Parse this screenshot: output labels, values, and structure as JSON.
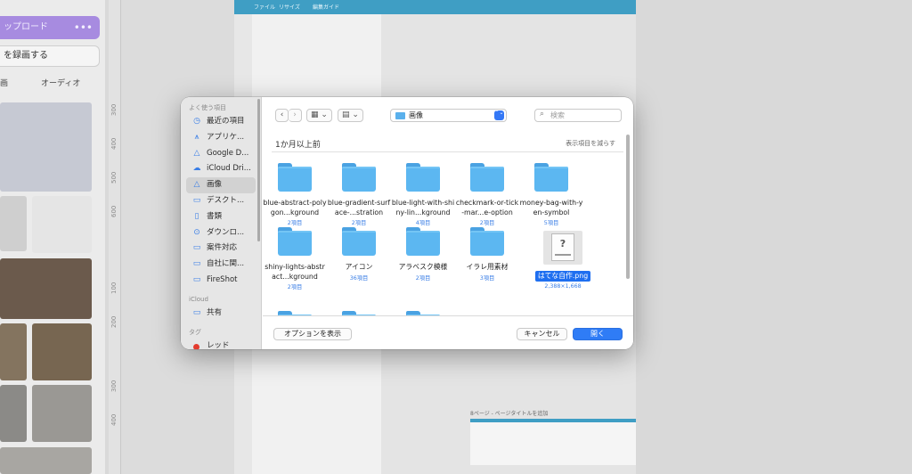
{
  "background": {
    "upload_label": "ップロード",
    "upload_more": "•••",
    "record_label": "を録画する",
    "tab_images": "画",
    "tab_audio": "オーディオ",
    "ruler_ticks": [
      "300",
      "400",
      "500",
      "600",
      "100",
      "200",
      "300",
      "400"
    ],
    "canva_menu": [
      "ファイル",
      "リサイズ",
      "編集ガイド"
    ],
    "page_label": "8ページ - ページタイトルを追加"
  },
  "sidebar": {
    "favorites_header": "よく使う項目",
    "favorites": [
      {
        "label": "最近の項目",
        "icon": "clock-icon",
        "glyph": "◷"
      },
      {
        "label": "アプリケ...",
        "icon": "apps-icon",
        "glyph": "⩚"
      },
      {
        "label": "Google D...",
        "icon": "drive-icon",
        "glyph": "△"
      },
      {
        "label": "iCloud Dri...",
        "icon": "cloud-icon",
        "glyph": "☁"
      },
      {
        "label": "画像",
        "icon": "drive-icon",
        "glyph": "△",
        "active": true
      },
      {
        "label": "デスクト...",
        "icon": "desktop-icon",
        "glyph": "▭"
      },
      {
        "label": "書類",
        "icon": "document-icon",
        "glyph": "▯"
      },
      {
        "label": "ダウンロ...",
        "icon": "download-icon",
        "glyph": "⊙"
      },
      {
        "label": "案件対応",
        "icon": "folder-icon",
        "glyph": "▭"
      },
      {
        "label": "自社に関...",
        "icon": "folder-icon",
        "glyph": "▭"
      },
      {
        "label": "FireShot",
        "icon": "folder-icon",
        "glyph": "▭"
      }
    ],
    "icloud_header": "iCloud",
    "icloud": [
      {
        "label": "共有",
        "icon": "shared-folder-icon",
        "glyph": "▭"
      }
    ],
    "tags_header": "タグ",
    "tags": [
      {
        "label": "レッド",
        "color": "#e33b2e"
      }
    ]
  },
  "toolbar": {
    "back": "‹",
    "forward": "›",
    "view_icon": "▦",
    "group_icon": "▤",
    "chevron": "⌄",
    "location": "画像",
    "location_arrows": "⌃⌄",
    "search_icon": "⌕",
    "search_placeholder": "検索"
  },
  "content": {
    "section_title": "1か月以上前",
    "show_less": "表示項目を減らす",
    "items": [
      {
        "name": "blue-abstract-polygon...kground",
        "meta": "2項目"
      },
      {
        "name": "blue-gradient-surface-...stration",
        "meta": "2項目"
      },
      {
        "name": "blue-light-with-shiny-lin...kground",
        "meta": "4項目"
      },
      {
        "name": "checkmark-or-tick-mar...e-option",
        "meta": "2項目"
      },
      {
        "name": "money-bag-with-yen-symbol",
        "meta": "5項目"
      },
      {
        "name": "shiny-lights-abstract...kground",
        "meta": "2項目"
      },
      {
        "name": "アイコン",
        "meta": "36項目"
      },
      {
        "name": "アラベスク模様",
        "meta": "2項目"
      },
      {
        "name": "イラレ用素材",
        "meta": "3項目"
      }
    ],
    "selected_file": {
      "name": "はてな自作.png",
      "meta": "2,388×1,668",
      "thumb_glyph": "?"
    }
  },
  "footer": {
    "options_label": "オプションを表示",
    "cancel_label": "キャンセル",
    "open_label": "開く"
  },
  "colors": {
    "accent": "#2f7cf6",
    "folder": "#5cb7f1",
    "tag_red": "#e33b2e"
  }
}
